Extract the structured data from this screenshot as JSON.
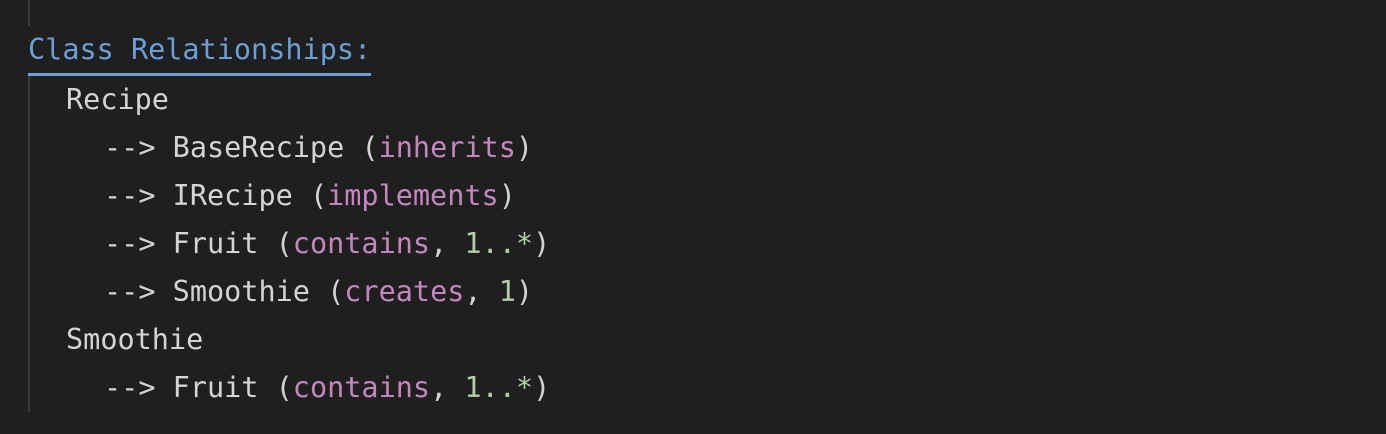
{
  "heading": "Class Relationships:",
  "arrow": "-->",
  "open_paren": "(",
  "close_paren": ")",
  "comma": ",",
  "lines": {
    "recipe": "Recipe",
    "rel1": {
      "target": "BaseRecipe",
      "kind": "inherits"
    },
    "rel2": {
      "target": "IRecipe",
      "kind": "implements"
    },
    "rel3": {
      "target": "Fruit",
      "kind": "contains",
      "multiplicity": "1..*"
    },
    "rel4": {
      "target": "Smoothie",
      "kind": "creates",
      "multiplicity": "1"
    },
    "smoothie": "Smoothie",
    "rel5": {
      "target": "Fruit",
      "kind": "contains",
      "multiplicity": "1..*"
    }
  },
  "colors": {
    "background": "#1f1f1f",
    "heading": "#6a9fd8",
    "text": "#d4d4d4",
    "keyword": "#c586c0",
    "number": "#b5cea8"
  }
}
